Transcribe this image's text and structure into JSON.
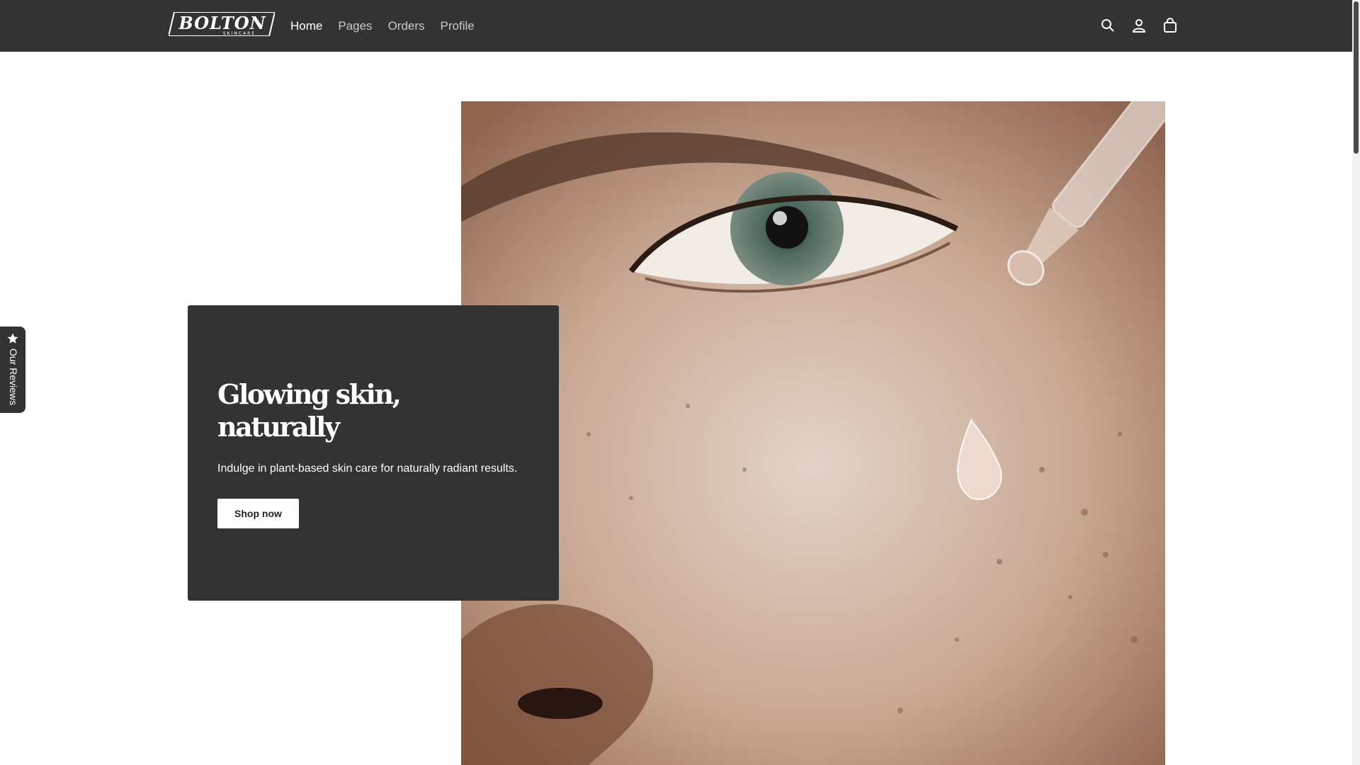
{
  "header": {
    "brand": "BOLTON",
    "brand_sub": "SKINCARE",
    "nav": [
      {
        "label": "Home",
        "active": true
      },
      {
        "label": "Pages",
        "active": false
      },
      {
        "label": "Orders",
        "active": false
      },
      {
        "label": "Profile",
        "active": false
      }
    ],
    "icons": [
      "search-icon",
      "account-icon",
      "cart-icon"
    ]
  },
  "hero": {
    "title_line1": "Glowing skin,",
    "title_line2": "naturally",
    "description": "Indulge in plant-based skin care for naturally radiant results.",
    "button_label": "Shop now"
  },
  "reviews_tab": {
    "label": "Our Reviews",
    "icon": "star-icon"
  },
  "colors": {
    "header_bg": "#333333",
    "card_bg": "#333333",
    "page_bg": "#ffffff",
    "button_bg": "#ffffff"
  }
}
